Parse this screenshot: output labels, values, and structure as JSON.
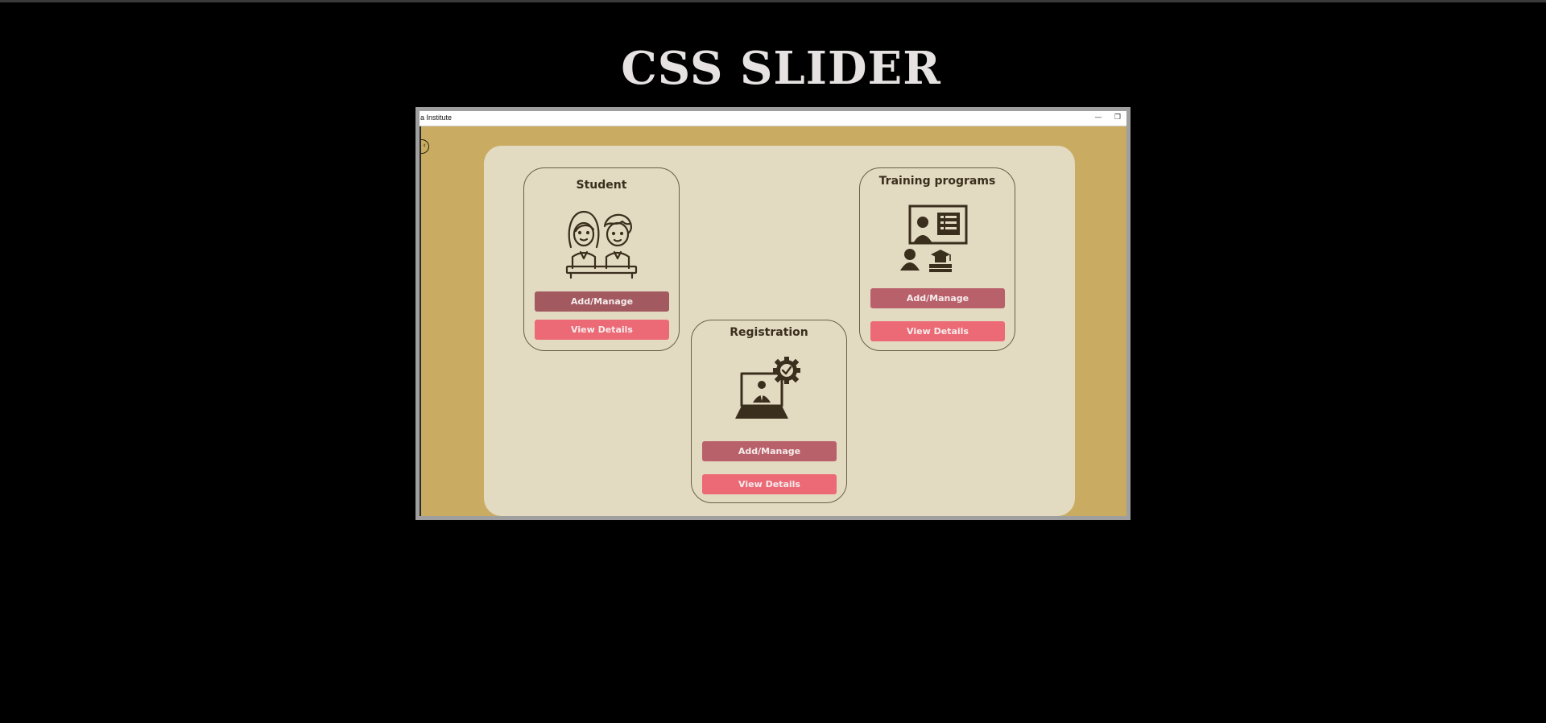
{
  "page": {
    "heading": "CSS SLIDER"
  },
  "window": {
    "title": "a Institute",
    "minimize_glyph": "—",
    "maximize_glyph": "❐",
    "back_glyph": "‹",
    "colors": {
      "background": "#c9ac62",
      "panel": "#e3dac2",
      "text": "#3a2f1d"
    }
  },
  "cards": {
    "student": {
      "title": "Student",
      "icon": "students-icon",
      "manage_label": "Add/Manage",
      "view_label": "View Details"
    },
    "registration": {
      "title": "Registration",
      "icon": "laptop-registration-icon",
      "manage_label": "Add/Manage",
      "view_label": "View Details"
    },
    "training": {
      "title": "Training programs",
      "icon": "classroom-icon",
      "manage_label": "Add/Manage",
      "view_label": "View Details"
    }
  },
  "button_colors": {
    "manage": "#b9616b",
    "view": "#ec6a76"
  }
}
